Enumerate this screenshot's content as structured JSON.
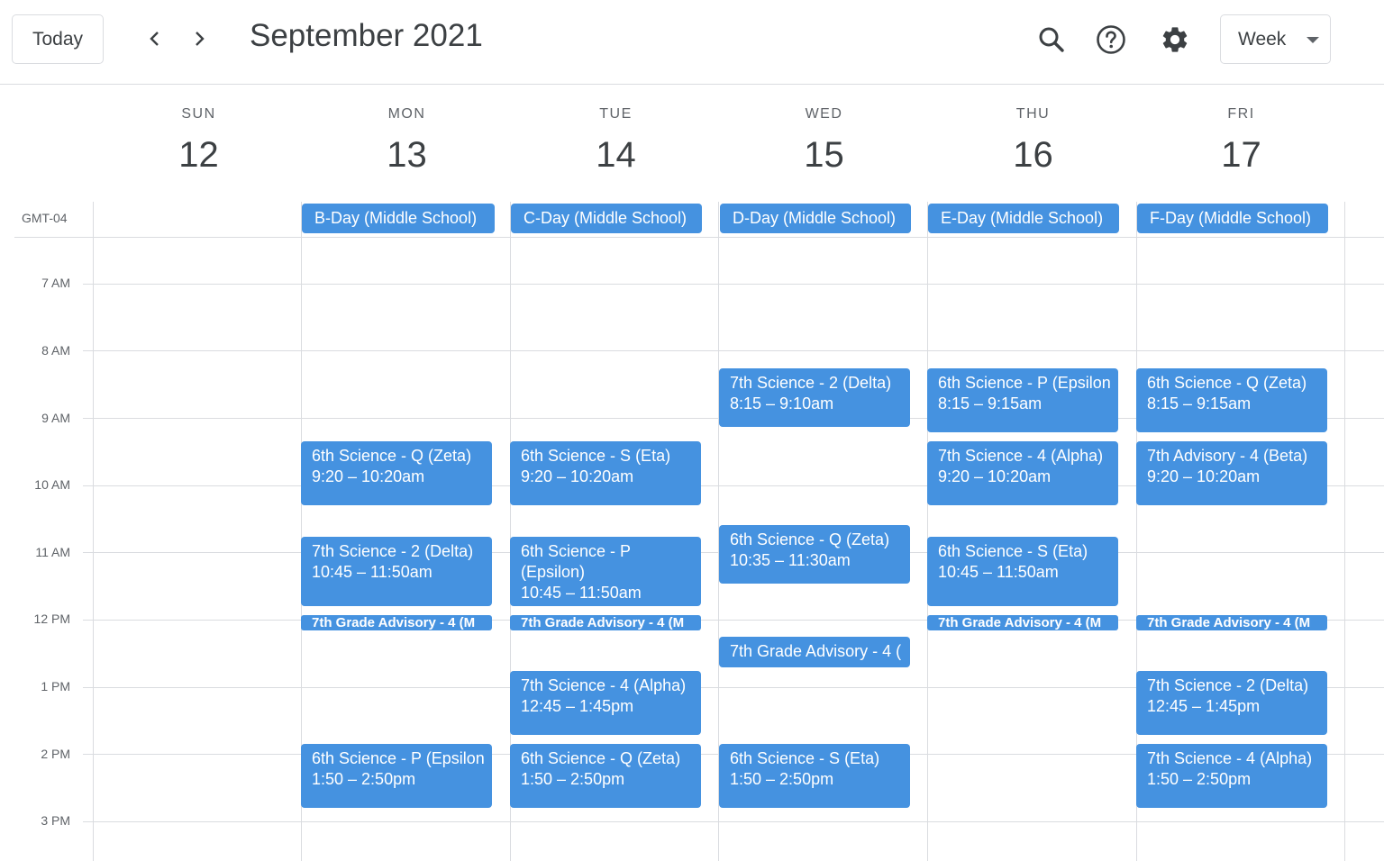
{
  "header": {
    "today_label": "Today",
    "title": "September 2021",
    "view_label": "Week",
    "icons": [
      "chevron-left-icon",
      "chevron-right-icon",
      "search-icon",
      "help-icon",
      "settings-icon",
      "dropdown-caret-icon"
    ]
  },
  "timezone": "GMT-04",
  "days": [
    {
      "dow": "SUN",
      "num": "12"
    },
    {
      "dow": "MON",
      "num": "13"
    },
    {
      "dow": "TUE",
      "num": "14"
    },
    {
      "dow": "WED",
      "num": "15"
    },
    {
      "dow": "THU",
      "num": "16"
    },
    {
      "dow": "FRI",
      "num": "17"
    }
  ],
  "hours": [
    "7 AM",
    "8 AM",
    "9 AM",
    "10 AM",
    "11 AM",
    "12 PM",
    "1 PM",
    "2 PM",
    "3 PM"
  ],
  "allday": {
    "mon": "B-Day (Middle School)",
    "tue": "C-Day (Middle School)",
    "wed": "D-Day (Middle School)",
    "thu": "E-Day (Middle School)",
    "fri": "F-Day (Middle School)"
  },
  "events": {
    "mon": [
      {
        "title": "6th Science - Q (Zeta)",
        "time": "9:20 – 10:20am"
      },
      {
        "title": "7th Science - 2 (Delta)",
        "time": "10:45 – 11:50am"
      },
      {
        "title": "7th Grade Advisory - 4 (M"
      },
      {
        "title": "6th Science - P (Epsilon",
        "time": "1:50 – 2:50pm"
      }
    ],
    "tue": [
      {
        "title": "6th Science - S (Eta)",
        "time": "9:20 – 10:20am"
      },
      {
        "title": "6th Science - P (Epsilon)",
        "time": "10:45 – 11:50am"
      },
      {
        "title": "7th Grade Advisory - 4 (M"
      },
      {
        "title": "7th Science - 4 (Alpha)",
        "time": "12:45 – 1:45pm"
      },
      {
        "title": "6th Science - Q (Zeta)",
        "time": "1:50 – 2:50pm"
      }
    ],
    "wed": [
      {
        "title": "7th Science - 2 (Delta)",
        "time": "8:15 – 9:10am"
      },
      {
        "title": "6th Science - Q (Zeta)",
        "time": "10:35 – 11:30am"
      },
      {
        "title": "7th Grade Advisory - 4 ("
      },
      {
        "title": "6th Science - S (Eta)",
        "time": "1:50 – 2:50pm"
      }
    ],
    "thu": [
      {
        "title": "6th Science - P (Epsilon",
        "time": "8:15 – 9:15am"
      },
      {
        "title": "7th Science - 4 (Alpha)",
        "time": "9:20 – 10:20am"
      },
      {
        "title": "6th Science - S (Eta)",
        "time": "10:45 – 11:50am"
      },
      {
        "title": "7th Grade Advisory - 4 (M"
      }
    ],
    "fri": [
      {
        "title": "6th Science - Q (Zeta)",
        "time": "8:15 – 9:15am"
      },
      {
        "title": "7th Advisory - 4 (Beta)",
        "time": "9:20 – 10:20am"
      },
      {
        "title": "7th Grade Advisory - 4 (M"
      },
      {
        "title": "7th Science - 2 (Delta)",
        "time": "12:45 – 1:45pm"
      },
      {
        "title": "7th Science - 4 (Alpha)",
        "time": "1:50 – 2:50pm"
      }
    ]
  },
  "colors": {
    "event": "#4592e0",
    "grid": "#dadce0",
    "text": "#3c4043"
  }
}
